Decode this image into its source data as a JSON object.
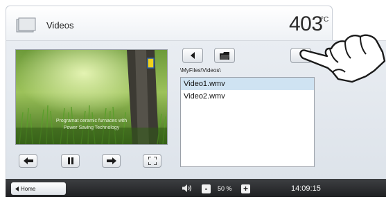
{
  "header": {
    "title": "Videos",
    "temperature": "403",
    "temperature_unit": "°C",
    "folder_icon": "folder-icon"
  },
  "video": {
    "caption_line1": "Programat ceramic furnaces with",
    "caption_line2": "Power Saving Technology"
  },
  "controls": {
    "icons": [
      "rewind-icon",
      "pause-icon",
      "forward-icon",
      "fullscreen-icon"
    ]
  },
  "file_browser": {
    "path": "\\MyFiles\\Videos\\",
    "files": [
      {
        "name": "Video1.wmv",
        "selected": true
      },
      {
        "name": "Video2.wmv",
        "selected": false
      }
    ]
  },
  "footer": {
    "home_label": "Home",
    "volume_value": "50 %",
    "volume_minus": "-",
    "volume_plus": "+",
    "time": "14:09:15"
  },
  "colors": {
    "selected_row": "#cfe3f2",
    "footer_bg": "#2a2b2d"
  }
}
